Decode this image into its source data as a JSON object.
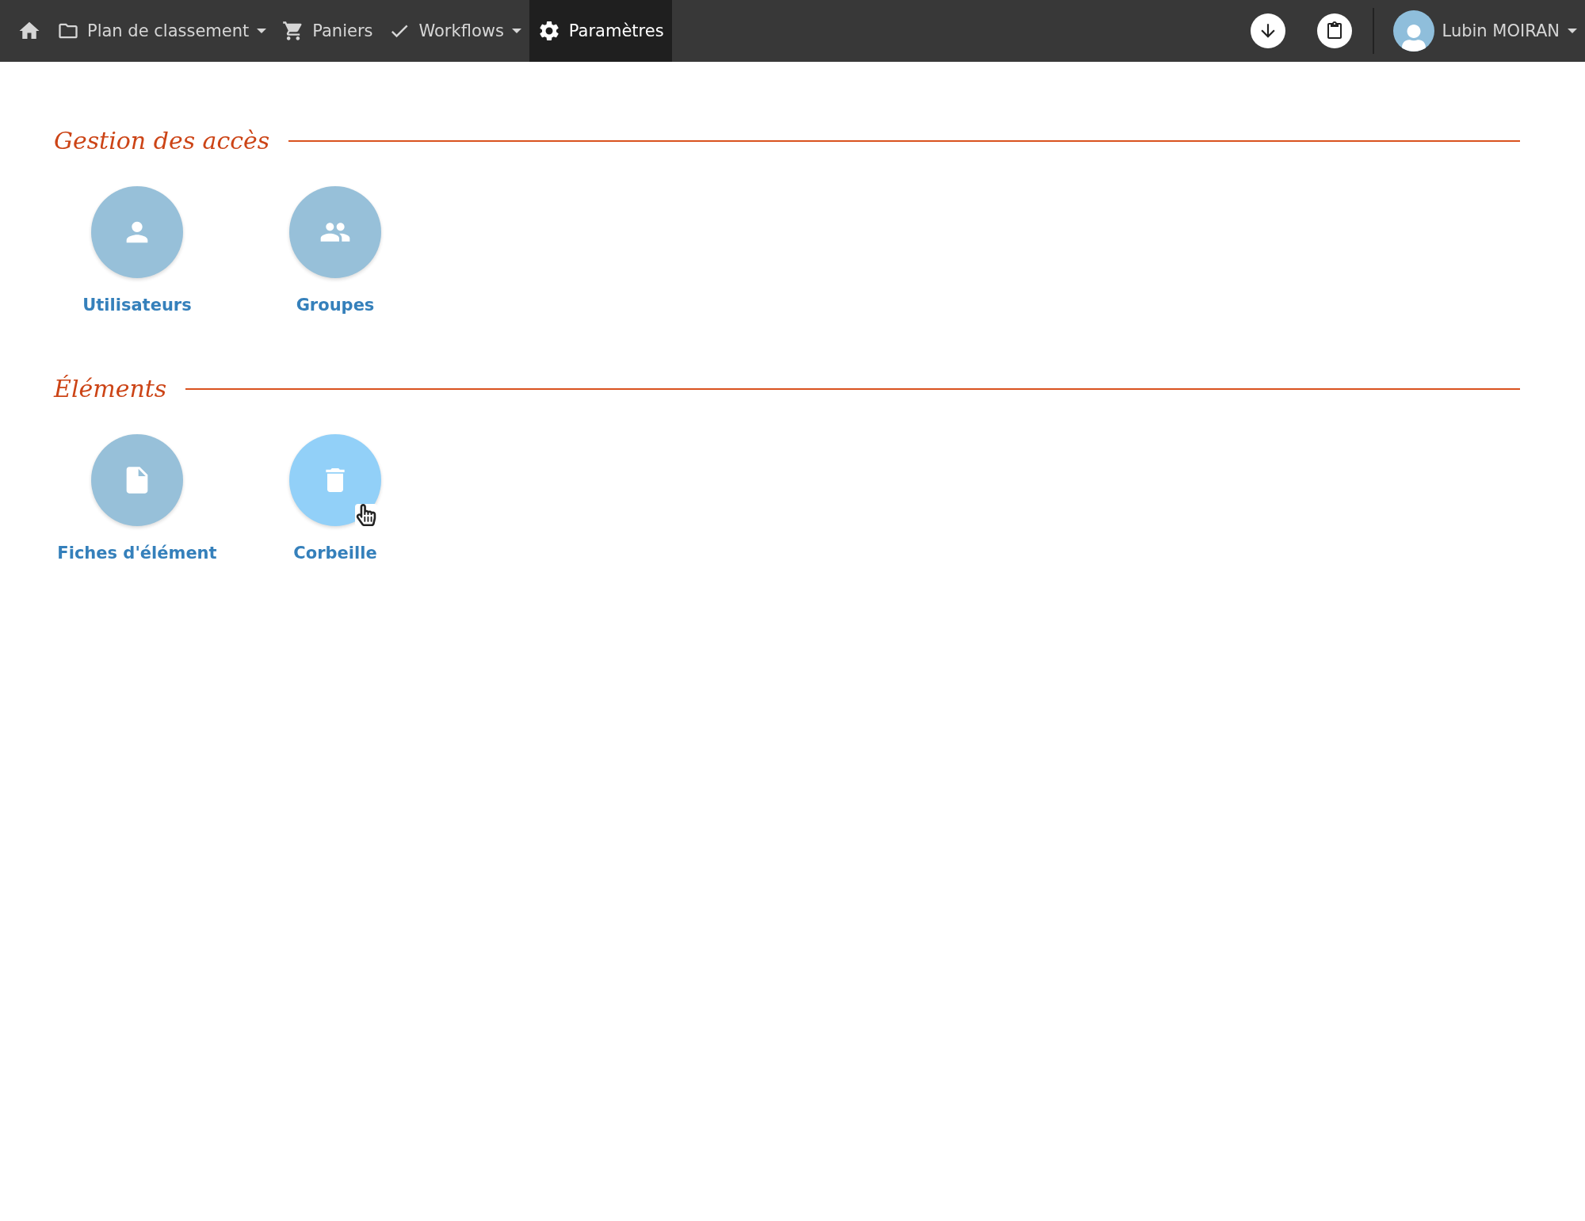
{
  "navbar": {
    "items": [
      {
        "label": "Plan de classement",
        "has_menu": true,
        "selected": false
      },
      {
        "label": "Paniers",
        "has_menu": false,
        "selected": false
      },
      {
        "label": "Workflows",
        "has_menu": true,
        "selected": false
      },
      {
        "label": "Paramètres",
        "has_menu": false,
        "selected": true
      }
    ],
    "user": {
      "name": "Lubin MOIRAN",
      "has_menu": true
    }
  },
  "sections": [
    {
      "title": "Gestion des accès",
      "tiles": [
        {
          "label": "Utilisateurs",
          "hovered": false
        },
        {
          "label": "Groupes",
          "hovered": false
        }
      ]
    },
    {
      "title": "Éléments",
      "tiles": [
        {
          "label": "Fiches d'élément",
          "hovered": false
        },
        {
          "label": "Corbeille",
          "hovered": true
        }
      ]
    }
  ]
}
